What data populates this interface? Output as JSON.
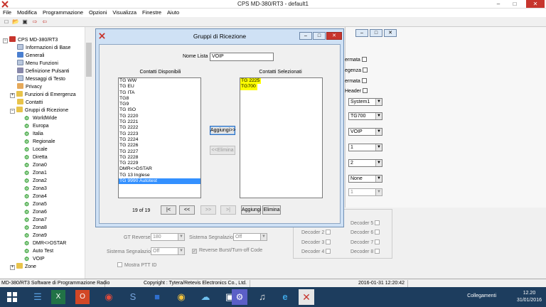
{
  "window": {
    "title": "CPS MD-380/RT3 - default1"
  },
  "menu": [
    "File",
    "Modifica",
    "Programmazione",
    "Opzioni",
    "Visualizza",
    "Finestre",
    "Aiuto"
  ],
  "tree": {
    "root": "CPS MD-380/RT3",
    "items": [
      "Informazioni di Base",
      "Generali",
      "Menu Funzioni",
      "Definizione Pulsanti",
      "Messaggi di Testo",
      "Privacy",
      "Funzioni di Emergenza",
      "Contatti",
      "Gruppi di Ricezione"
    ],
    "groups": [
      "WorldWide",
      "Europa",
      "Italia",
      "Regionale",
      "Locale",
      "Diretta",
      "Zona0",
      "Zona1",
      "Zona2",
      "Zona3",
      "Zona4",
      "Zona5",
      "Zona6",
      "Zona7",
      "Zona8",
      "Zona9",
      "DMR<>DSTAR",
      "Auto Test",
      "VOIP"
    ],
    "last": "Zone"
  },
  "bg": {
    "checks": [
      "ermata",
      "egenza",
      "ermata",
      "Header"
    ],
    "selects": [
      "System1",
      "TG700",
      "VOIP",
      "1",
      "2",
      "None",
      "1"
    ],
    "decoders_left": [
      "Decoder 2",
      "Decoder 3",
      "Decoder 4"
    ],
    "decoders_right": [
      "Decoder 5",
      "Decoder 6",
      "Decoder 7",
      "Decoder 8"
    ],
    "gt_reverse_label": "GT Reverse",
    "gt_reverse_value": "180",
    "sistema_label": "Sistema Segnalazione",
    "sistema_value": "Off",
    "sistema2_label": "Sistema Segnalazione",
    "sistema2_value": "Off",
    "reverse_burst": "Reverse Burst/Turn-off Code",
    "mostra_ptt": "Mostra PTT ID"
  },
  "dialog": {
    "title": "Gruppi di Ricezione",
    "name_label": "Nome Lista",
    "name_value": "VOIP",
    "available_label": "Contatti Disponibili",
    "selected_label": "Contatti Selezionati",
    "available": [
      "TG WW",
      "TG EU",
      "TG ITA",
      "TG8",
      "TG9",
      "TG ISO",
      "TG 2220",
      "TG 2221",
      "TG 2222",
      "TG 2223",
      "TG 2224",
      "TG 2226",
      "TG 2227",
      "TG 2228",
      "TG 2229",
      "DMR<>DSTAR",
      "TG 13 Inglese",
      "TG 9990 Autotest"
    ],
    "selected": [
      "TG 2225",
      "TG700"
    ],
    "add_btn": "Aggiungi>>",
    "remove_btn": "<<Elimina",
    "pager": "19 of 19",
    "nav": [
      "|<",
      "<<",
      ">>",
      ">|"
    ],
    "add2_btn": "Aggiungi",
    "del2_btn": "Elimina"
  },
  "status": {
    "app": "MD-380/RT3 Software di Programmazione Radio",
    "copyright": "Copyright : Tytera/Retevis Electronics Co., Ltd.",
    "datetime": "2016-01-31 12:20:42"
  },
  "taskbar": {
    "network": "Collegamenti",
    "time": "12.20",
    "date": "31/01/2016"
  }
}
